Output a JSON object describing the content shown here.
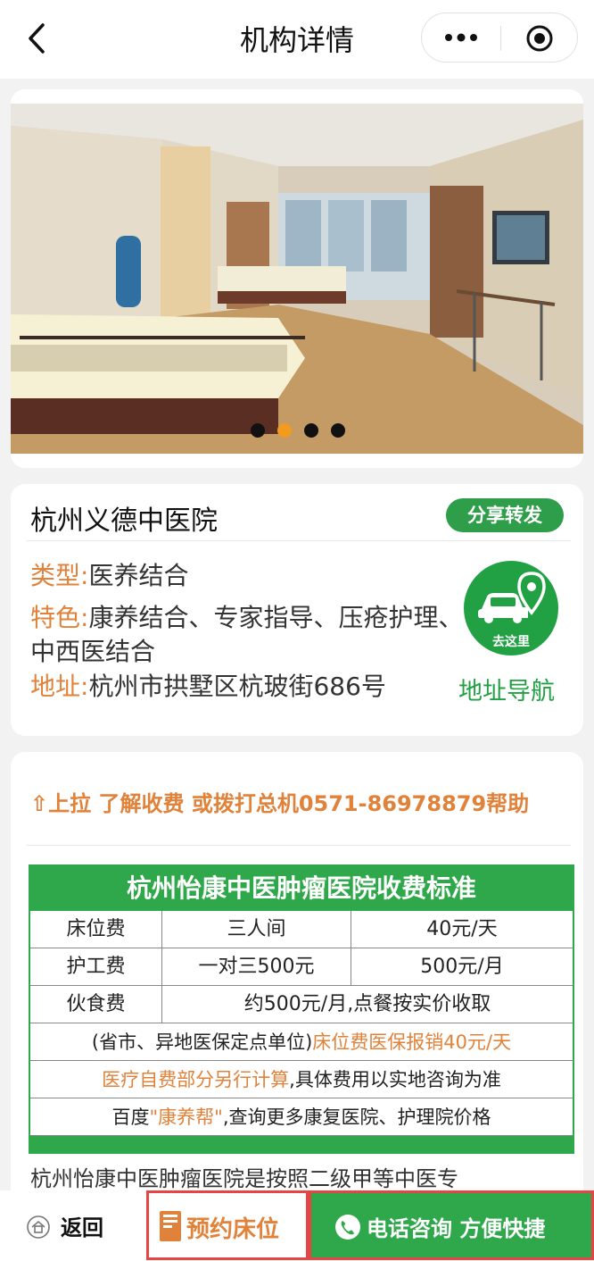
{
  "header": {
    "title": "机构详情"
  },
  "banner": {
    "slides_total": 4,
    "active_slide": 2,
    "dot_active_color": "#f39a21"
  },
  "institution": {
    "name": "杭州义德中医院",
    "share_label": "分享转发",
    "type_label": "类型:",
    "type_value": "医养结合",
    "feature_label": "特色:",
    "feature_value": "康养结合、专家指导、压疮护理、中西医结合",
    "address_label": "地址:",
    "address_value": "杭州市拱墅区杭玻街686号",
    "go_label": "去这里",
    "nav_link": "地址导航"
  },
  "fees": {
    "hint": "⇧上拉 了解收费 或拨打总机0571-86978879帮助",
    "table_title": "杭州怡康中医肿瘤医院收费标准",
    "rows": [
      [
        "床位费",
        "三人间",
        "40元/天"
      ],
      [
        "护工费",
        "一对三500元",
        "500元/月"
      ],
      [
        "伙食费",
        "约500元/月,点餐按实价收取"
      ]
    ],
    "note1_a": "(省市、异地医保定点单位)",
    "note1_b": "床位费医保报销40元/天",
    "note2_a": "医疗自费部分另行计算",
    "note2_b": ",具体费用以实地咨询为准",
    "note3_a": "百度",
    "note3_b": "\"康养帮\"",
    "note3_c": ",查询更多康复医院、护理院价格",
    "description": "杭州怡康中医肿瘤医院是按照二级甲等中医专"
  },
  "bottom_bar": {
    "return_label": "返回",
    "book_label": "预约床位",
    "call_label": "电话咨询 方便快捷"
  },
  "colors": {
    "green": "#2ea84a",
    "orange": "#e0823a",
    "red_border": "#e64545"
  }
}
